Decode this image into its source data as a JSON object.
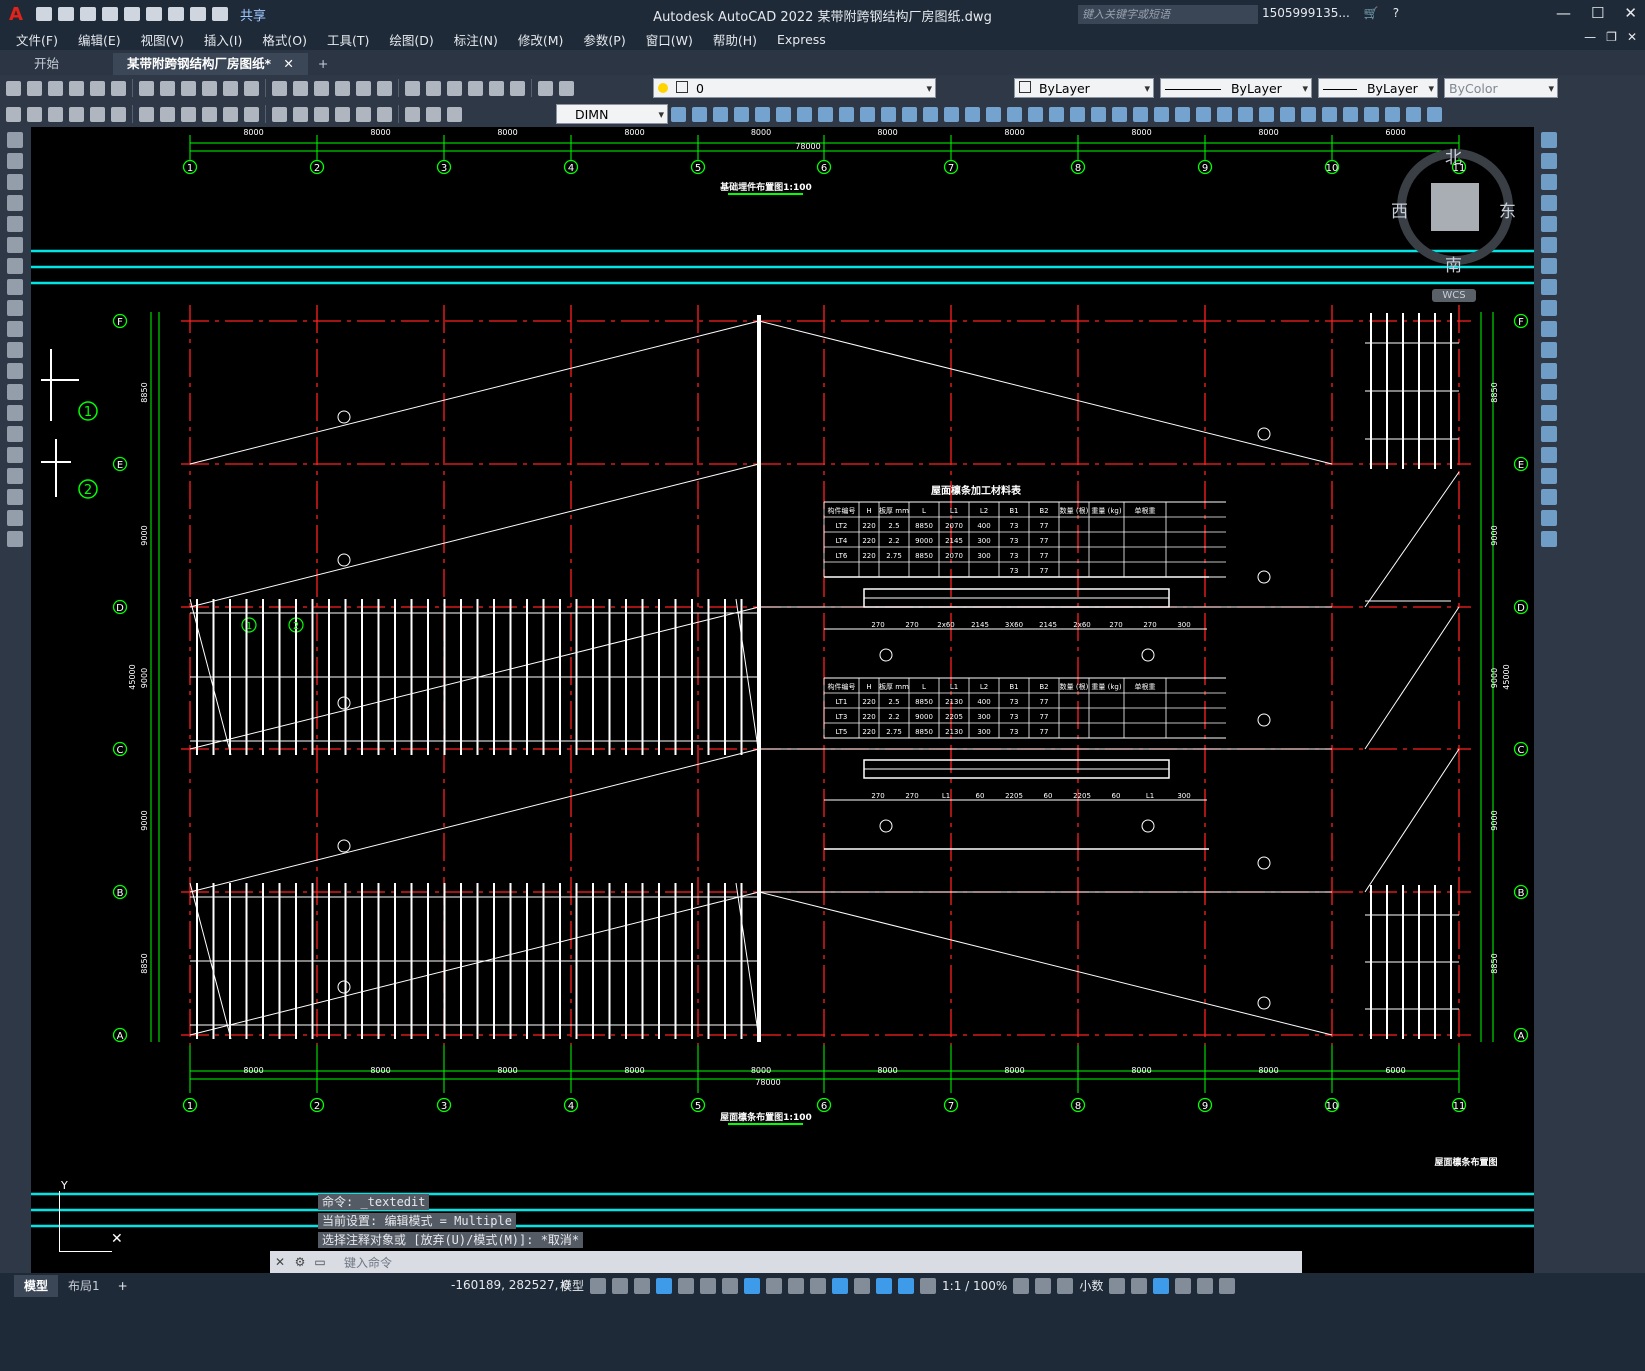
{
  "app": {
    "logo": "A",
    "title": "Autodesk AutoCAD 2022    某带附跨钢结构厂房图纸.dwg",
    "share": "共享",
    "search_placeholder": "键入关键字或短语",
    "user": "1505999135...",
    "help": "?"
  },
  "menu": [
    "文件(F)",
    "编辑(E)",
    "视图(V)",
    "插入(I)",
    "格式(O)",
    "工具(T)",
    "绘图(D)",
    "标注(N)",
    "修改(M)",
    "参数(P)",
    "窗口(W)",
    "帮助(H)",
    "Express"
  ],
  "tabs": {
    "start": "开始",
    "drawing": "某带附跨钢结构厂房图纸*",
    "close": "✕",
    "add": "+"
  },
  "layer": {
    "current": "0",
    "color": "ByLayer",
    "linetype": "ByLayer",
    "lineweight": "ByLayer",
    "plotstyle": "ByColor"
  },
  "dimstyle": "DIMN",
  "viewcube": {
    "north": "北",
    "south": "南",
    "east": "东",
    "west": "西",
    "wcs": "WCS"
  },
  "drawing": {
    "top_title": "基础埋件布置图1:100",
    "bottom_title": "屋面檩条布置图1:100",
    "corner_title": "屋面檩条布置图",
    "table_title": "屋面檩条加工材料表",
    "table_headers": [
      "构件编号",
      "H",
      "板厚 mm",
      "L",
      "L1",
      "L2",
      "B1",
      "B2",
      "数量 (根)",
      "重量 (kg)",
      "单根重"
    ],
    "table1_rows": [
      [
        "LT2",
        "220",
        "2.5",
        "8850",
        "2070",
        "400",
        "73",
        "77"
      ],
      [
        "LT4",
        "220",
        "2.2",
        "9000",
        "2145",
        "300",
        "73",
        "77"
      ],
      [
        "LT6",
        "220",
        "2.75",
        "8850",
        "2070",
        "300",
        "73",
        "77"
      ],
      [
        "",
        "",
        "",
        "",
        "",
        "",
        "73",
        "77"
      ]
    ],
    "table2_rows": [
      [
        "LT1",
        "220",
        "2.5",
        "8850",
        "2130",
        "400",
        "73",
        "77"
      ],
      [
        "LT3",
        "220",
        "2.2",
        "9000",
        "2205",
        "300",
        "73",
        "77"
      ],
      [
        "LT5",
        "220",
        "2.75",
        "8850",
        "2130",
        "300",
        "73",
        "77"
      ]
    ],
    "axis_numbers": [
      "1",
      "2",
      "3",
      "4",
      "5",
      "6",
      "7",
      "8",
      "9",
      "10",
      "11"
    ],
    "axis_letters": [
      "F",
      "E",
      "D",
      "C",
      "B",
      "A"
    ],
    "bay_dims": [
      "8000",
      "8000",
      "8000",
      "8000",
      "8000",
      "8000",
      "8000",
      "8000",
      "8000",
      "6000"
    ],
    "total_dim": "78000",
    "side_dims": [
      "8850",
      "9000",
      "9000",
      "9000",
      "8850"
    ],
    "side_total": "45000",
    "detail_labels": [
      "1",
      "2"
    ],
    "dim_row1": [
      "270",
      "270",
      "2x60",
      "2145",
      "3X60",
      "2145",
      "2x60",
      "270",
      "270",
      "300"
    ],
    "dim_row2": [
      "270",
      "270",
      "L1",
      "60",
      "2205",
      "60",
      "2205",
      "60",
      "L1",
      "300"
    ]
  },
  "commands": [
    "命令: _textedit",
    "当前设置: 编辑模式 = Multiple",
    "选择注释对象或 [放弃(U)/模式(M)]: *取消*"
  ],
  "command_placeholder": "键入命令",
  "status": {
    "model_tab": "模型",
    "layout_tab": "布局1",
    "coords": "-160189, 282527, 0",
    "model": "模型",
    "scale": "1:1 / 100%",
    "units": "小数"
  },
  "colors": {
    "accent": "#3d9be9",
    "cyan_line": "#00e5e5",
    "axis_red": "#ff2020",
    "grid_green": "#00ff00",
    "white_line": "#ffffff"
  }
}
